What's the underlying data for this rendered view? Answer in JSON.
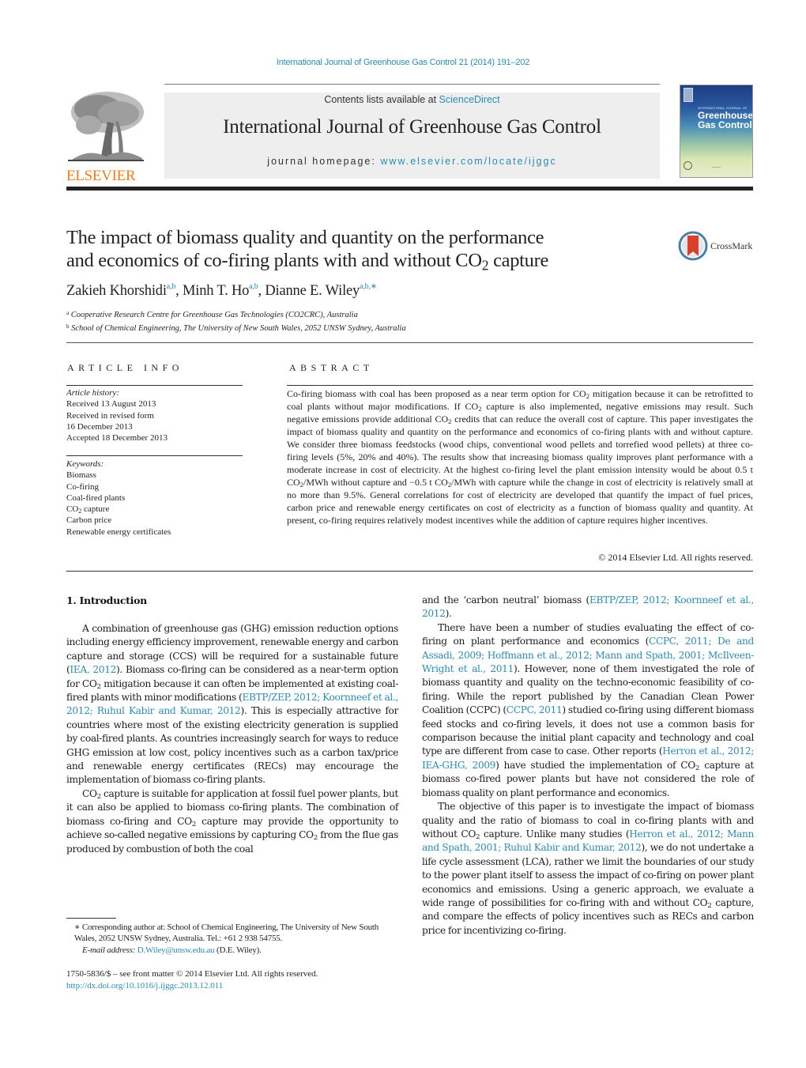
{
  "running_head": "International Journal of Greenhouse Gas Control 21 (2014) 191–202",
  "masthead": {
    "publisher_logo_text": "ELSEVIER",
    "contents_prefix": "Contents lists available at ",
    "contents_link": "ScienceDirect",
    "journal_name": "International Journal of Greenhouse Gas Control",
    "homepage_prefix": "journal homepage: ",
    "homepage_link": "www.elsevier.com/locate/ijggc",
    "cover": {
      "overtitle": "INTERNATIONAL JOURNAL OF",
      "title_line1": "Greenhouse",
      "title_line2": "Gas Control",
      "gradient_top": "#1f3c83",
      "gradient_bottom": "#e7eccf"
    },
    "brand_color": "#f07d16",
    "link_color": "#2a8cb4"
  },
  "article": {
    "title_line1": "The impact of biomass quality and quantity on the performance",
    "title_line2_pre": "and economics of co-firing plants with and without CO",
    "title_line2_sub": "2",
    "title_line2_post": " capture",
    "crossmark_label": "CrossMark",
    "authors": [
      {
        "name": "Zakieh Khorshidi",
        "affil": "a,b",
        "sep": ", "
      },
      {
        "name": "Minh T. Ho",
        "affil": "a,b",
        "sep": ", "
      },
      {
        "name": "Dianne E. Wiley",
        "affil": "a,b,∗",
        "sep": ""
      }
    ],
    "affiliations": [
      {
        "mark": "a",
        "text": "Cooperative Research Centre for Greenhouse Gas Technologies (CO2CRC), Australia"
      },
      {
        "mark": "b",
        "text": "School of Chemical Engineering, The University of New South Wales, 2052 UNSW Sydney, Australia"
      }
    ]
  },
  "article_info": {
    "heading": "ARTICLE INFO",
    "history_label": "Article history:",
    "history": [
      "Received 13 August 2013",
      "Received in revised form",
      "16 December 2013",
      "Accepted 18 December 2013"
    ],
    "keywords_label": "Keywords:",
    "keywords": [
      "Biomass",
      "Co-firing",
      "Coal-fired plants",
      "CO2 capture",
      "Carbon price",
      "Renewable energy certificates"
    ]
  },
  "abstract": {
    "heading": "ABSTRACT",
    "segments": [
      "Co-firing biomass with coal has been proposed as a near term option for CO",
      " mitigation because it can be retrofitted to coal plants without major modifications. If CO",
      " capture is also implemented, negative emissions may result. Such negative emissions provide additional CO",
      " credits that can reduce the overall cost of capture. This paper investigates the impact of biomass quality and quantity on the performance and economics of co-firing plants with and without capture. We consider three biomass feedstocks (wood chips, conventional wood pellets and torrefied wood pellets) at three co-firing levels (5%, 20% and 40%). The results show that increasing biomass quality improves plant performance with a moderate increase in cost of electricity. At the highest co-firing level the plant emission intensity would be about 0.5 t CO",
      "/MWh without capture and −0.5 t CO",
      "/MWh with capture while the change in cost of electricity is relatively small at no more than 9.5%. General correlations for cost of electricity are developed that quantify the impact of fuel prices, carbon price and renewable energy certificates on cost of electricity as a function of biomass quality and quantity. At present, co-firing requires relatively modest incentives while the addition of capture requires higher incentives."
    ],
    "copyright": "© 2014 Elsevier Ltd. All rights reserved."
  },
  "introduction": {
    "heading": "1.  Introduction",
    "left": {
      "p1": [
        "A combination of greenhouse gas (GHG) emission reduction options including energy efficiency improvement, renewable energy and carbon capture and storage (CCS) will be required for a sustainable future (",
        "IEA, 2012",
        "). Biomass co-firing can be considered as a near-term option for CO",
        " mitigation because it can often be implemented at existing coal-fired plants with minor modifications (",
        "EBTP/ZEP, 2012; Koornneef et al., 2012; Ruhul Kabir and Kumar, 2012",
        "). This is especially attractive for countries where most of the existing electricity generation is supplied by coal-fired plants. As countries increasingly search for ways to reduce GHG emission at low cost, policy incentives such as a carbon tax/price and renewable energy certificates (RECs) may encourage the implementation of biomass co-firing plants."
      ],
      "p2": [
        "CO",
        " capture is suitable for application at fossil fuel power plants, but it can also be applied to biomass co-firing plants. The combination of biomass co-firing and CO",
        " capture may provide the opportunity to achieve so-called negative emissions by capturing CO",
        " from the flue gas produced by combustion of both the coal"
      ]
    },
    "right": {
      "p0": [
        "and the ‘carbon neutral’ biomass (",
        "EBTP/ZEP, 2012; Koornneef et al., 2012",
        ")."
      ],
      "p1": [
        "There have been a number of studies evaluating the effect of co-firing on plant performance and economics (",
        "CCPC, 2011; De and Assadi, 2009; Hoffmann et al., 2012; Mann and Spath, 2001; McIlveen-Wright et al., 2011",
        "). However, none of them investigated the role of biomass quantity and quality on the techno-economic feasibility of co-firing. While the report published by the Canadian Clean Power Coalition (CCPC) (",
        "CCPC, 2011",
        ") studied co-firing using different biomass feed stocks and co-firing levels, it does not use a common basis for comparison because the initial plant capacity and technology and coal type are different from case to case. Other reports (",
        "Herron et al., 2012; IEA-GHG, 2009",
        ") have studied the implementation of CO",
        " capture at biomass co-fired power plants but have not considered the role of biomass quality on plant performance and economics."
      ],
      "p2": [
        "The objective of this paper is to investigate the impact of biomass quality and the ratio of biomass to coal in co-firing plants with and without CO",
        " capture. Unlike many studies (",
        "Herron et al., 2012; Mann and Spath, 2001; Ruhul Kabir and Kumar, 2012",
        "), we do not undertake a life cycle assessment (LCA), rather we limit the boundaries of our study to the power plant itself to assess the impact of co-firing on power plant economics and emissions. Using a generic approach, we evaluate a wide range of possibilities for co-firing with and without CO",
        " capture, and compare the effects of policy incentives such as RECs and carbon price for incentivizing co-firing."
      ]
    }
  },
  "footnotes": {
    "corresponding": "∗  Corresponding author at: School of Chemical Engineering, The University of New South Wales, 2052 UNSW Sydney, Australia. Tel.: +61 2 938 54755.",
    "email_label": "E-mail address:",
    "email": "D.Wiley@unsw.edu.au",
    "email_suffix": " (D.E. Wiley).",
    "issn_line": "1750-5836/$ – see front matter © 2014 Elsevier Ltd. All rights reserved.",
    "doi": "http://dx.doi.org/10.1016/j.ijggc.2013.12.011"
  },
  "sub2": "2"
}
